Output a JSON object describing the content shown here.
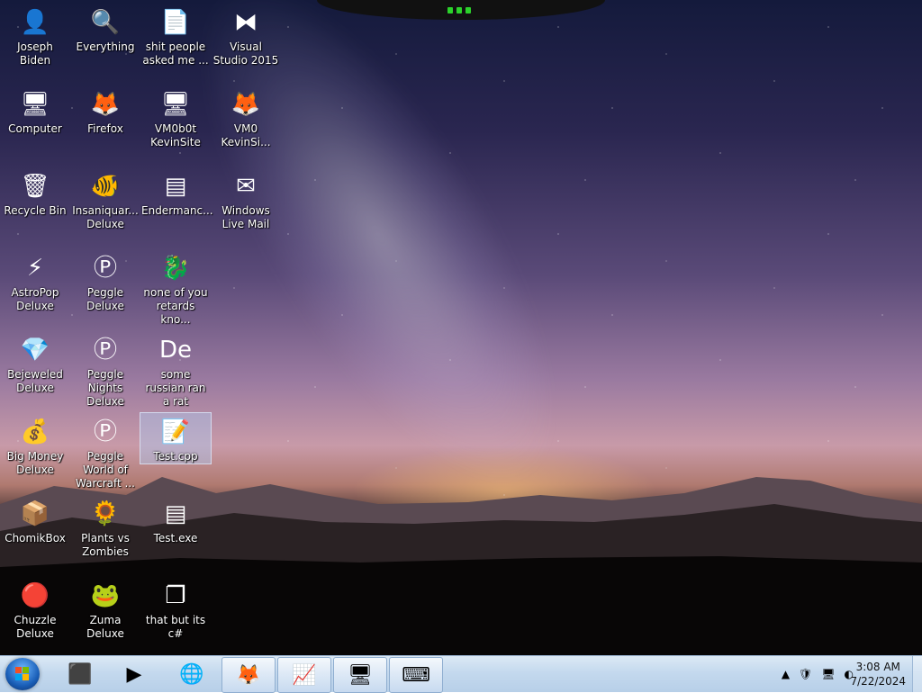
{
  "desktop": {
    "icons": [
      {
        "label": "Joseph Biden",
        "glyph": "👤",
        "icon": "user-icon"
      },
      {
        "label": "Everything",
        "glyph": "🔍",
        "icon": "search-icon"
      },
      {
        "label": "shit people asked me ...",
        "glyph": "📄",
        "icon": "document-icon"
      },
      {
        "label": "Visual Studio 2015",
        "glyph": "⧓",
        "icon": "visual-studio-icon"
      },
      {
        "label": "Computer",
        "glyph": "🖥",
        "icon": "computer-icon"
      },
      {
        "label": "Firefox",
        "glyph": "🦊",
        "icon": "firefox-icon"
      },
      {
        "label": "VM0b0t KevinSite",
        "glyph": "🖥",
        "icon": "vm-icon"
      },
      {
        "label": "VM0 KevinSi...",
        "glyph": "🦊",
        "icon": "vm-firefox-icon"
      },
      {
        "label": "Recycle Bin",
        "glyph": "🗑",
        "icon": "recycle-bin-icon"
      },
      {
        "label": "Insaniquar... Deluxe",
        "glyph": "🐠",
        "icon": "fish-icon"
      },
      {
        "label": "Endermanc...",
        "glyph": "▤",
        "icon": "console-icon"
      },
      {
        "label": "Windows Live Mail",
        "glyph": "✉",
        "icon": "mail-icon"
      },
      {
        "label": "AstroPop Deluxe",
        "glyph": "⚡",
        "icon": "astropop-icon"
      },
      {
        "label": "Peggle Deluxe",
        "glyph": "Ⓟ",
        "icon": "peggle-icon"
      },
      {
        "label": "none of you retards kno...",
        "glyph": "🐉",
        "icon": "dragon-icon"
      },
      {
        "label": "Bejeweled Deluxe",
        "glyph": "💎",
        "icon": "gem-icon"
      },
      {
        "label": "Peggle Nights Deluxe",
        "glyph": "Ⓟ",
        "icon": "peggle-nights-icon"
      },
      {
        "label": "some russian ran a rat",
        "glyph": "De",
        "icon": "de-icon"
      },
      {
        "label": "Big Money Deluxe",
        "glyph": "💰",
        "icon": "money-bag-icon"
      },
      {
        "label": "Peggle World of Warcraft ...",
        "glyph": "Ⓟ",
        "icon": "peggle-wow-icon"
      },
      {
        "label": "Test.cpp",
        "glyph": "📝",
        "icon": "cpp-file-icon"
      },
      {
        "label": "ChomikBox",
        "glyph": "📦",
        "icon": "chomikbox-icon"
      },
      {
        "label": "Plants vs Zombies",
        "glyph": "🌻",
        "icon": "plant-icon"
      },
      {
        "label": "Test.exe",
        "glyph": "▤",
        "icon": "exe-icon"
      },
      {
        "label": "Chuzzle Deluxe",
        "glyph": "🔴",
        "icon": "chuzzle-icon"
      },
      {
        "label": "Zuma Deluxe",
        "glyph": "🐸",
        "icon": "zuma-icon"
      },
      {
        "label": "that but its c#",
        "glyph": "❐",
        "icon": "copy-icon"
      }
    ],
    "selected": "Test.cpp"
  },
  "taskbar": {
    "buttons": [
      {
        "name": "taskbar-terminal-button",
        "glyph": "⬛",
        "icon": "terminal-icon"
      },
      {
        "name": "taskbar-media-player-button",
        "glyph": "▶",
        "icon": "media-player-icon"
      },
      {
        "name": "taskbar-globe-button",
        "glyph": "🌐",
        "icon": "globe-icon"
      },
      {
        "name": "taskbar-firefox-button",
        "glyph": "🦊",
        "icon": "firefox-icon"
      },
      {
        "name": "taskbar-monitor-button",
        "glyph": "📈",
        "icon": "resource-monitor-icon"
      },
      {
        "name": "taskbar-remote-desktop-button",
        "glyph": "🖥",
        "icon": "remote-desktop-icon"
      },
      {
        "name": "taskbar-keyboard-button",
        "glyph": "⌨",
        "icon": "keyboard-icon"
      }
    ],
    "tray": [
      {
        "glyph": "▲",
        "icon": "show-hidden-icons-icon"
      },
      {
        "glyph": "🛡",
        "icon": "action-center-icon"
      },
      {
        "glyph": "🖥",
        "icon": "network-icon"
      },
      {
        "glyph": "◐",
        "icon": "volume-icon"
      }
    ],
    "clock": {
      "time": "3:08 AM",
      "date": "7/22/2024"
    }
  }
}
